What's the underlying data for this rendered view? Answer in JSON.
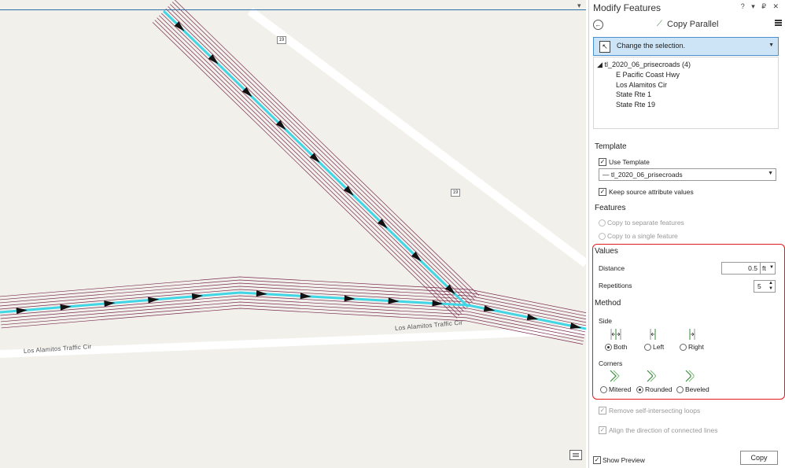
{
  "map": {
    "road_labels": {
      "left": "Los Alamitos Traffic Cir",
      "right": "Los Alamitos Traffic Cir"
    },
    "shields": [
      "19",
      "19"
    ]
  },
  "pane": {
    "title": "Modify Features",
    "window_controls": "? ▾ ₽ ✕",
    "tool": {
      "name": "Copy Parallel",
      "back_icon": "back-arrow-icon",
      "menu_icon": "hamburger-menu-icon"
    },
    "selection": {
      "label": "Change the selection."
    },
    "tree": {
      "root": "tl_2020_06_prisecroads (4)",
      "items": [
        "E Pacific Coast Hwy",
        "Los Alamitos Cir",
        "State Rte 1",
        "State Rte 19"
      ]
    },
    "template": {
      "heading": "Template",
      "use_template_label": "Use Template",
      "use_template_checked": true,
      "selected_template": "tl_2020_06_prisecroads",
      "keep_attrs_label": "Keep source attribute values",
      "keep_attrs_checked": true
    },
    "features": {
      "heading": "Features",
      "option_separate": "Copy to separate features",
      "option_single": "Copy to a single feature"
    },
    "values": {
      "heading": "Values",
      "distance_label": "Distance",
      "distance_value": "0.5",
      "distance_unit": "ft",
      "repetitions_label": "Repetitions",
      "repetitions_value": "5"
    },
    "method": {
      "heading": "Method",
      "side_label": "Side",
      "side_options": [
        "Both",
        "Left",
        "Right"
      ],
      "side_selected": "Both",
      "corners_label": "Corners",
      "corner_options": [
        "Mitered",
        "Rounded",
        "Beveled"
      ],
      "corner_selected": "Rounded"
    },
    "extra_options": {
      "remove_loops_label": "Remove self-intersecting loops",
      "align_direction_label": "Align the direction of connected lines"
    },
    "footer": {
      "show_preview_label": "Show Preview",
      "show_preview_checked": true,
      "copy_label": "Copy"
    }
  },
  "colors": {
    "accent": "#4a90d0",
    "selected_line": "#3fd6e6",
    "offset_lines": "#7a2a50",
    "highlight": "#e01b1b"
  }
}
